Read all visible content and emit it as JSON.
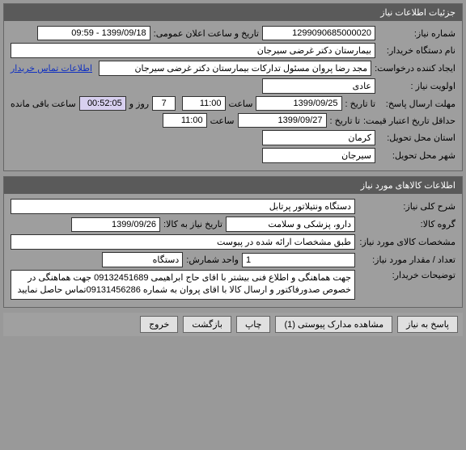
{
  "sections": {
    "need_info": {
      "title": "جزئیات اطلاعات نیاز",
      "rows": {
        "need_no_label": "شماره نیاز:",
        "need_no": "1299090685000020",
        "pub_datetime_label": "تاریخ و ساعت اعلان عمومی:",
        "pub_datetime": "1399/09/18 - 09:59",
        "buyer_org_label": "نام دستگاه خریدار:",
        "buyer_org": "بیمارستان دکتر غرضی سیرجان",
        "requester_label": "ایجاد کننده درخواست:",
        "requester": "مجد رضا پروان مسئول تدارکات بیمارستان دکتر غرضی سیرجان",
        "contact_link": "اطلاعات تماس خریدار",
        "priority_label": "اولویت نیاز :",
        "priority": "عادی",
        "reply_deadline_label": "مهلت ارسال پاسخ:",
        "until_label": "تا تاریخ :",
        "reply_until_date": "1399/09/25",
        "hour_label": "ساعت",
        "reply_until_time": "11:00",
        "days_remain": "7",
        "days_and": "روز و",
        "time_remain": "00:52:05",
        "time_remain_suffix": "ساعت باقی مانده",
        "min_validity_label": "حداقل تاریخ اعتبار قیمت:",
        "min_validity_date": "1399/09/27",
        "min_validity_time": "11:00",
        "delivery_province_label": "استان محل تحویل:",
        "delivery_province": "کرمان",
        "delivery_city_label": "شهر محل تحویل:",
        "delivery_city": "سیرجان"
      }
    },
    "goods_info": {
      "title": "اطلاعات کالاهای مورد نیاز",
      "rows": {
        "general_desc_label": "شرح کلی نیاز:",
        "general_desc": "دستگاه ونتیلاتور پرتابل",
        "goods_group_label": "گروه کالا:",
        "goods_group": "دارو، پزشکی و سلامت",
        "need_until_label": "تاریخ نیاز به کالا:",
        "need_until": "1399/09/26",
        "goods_spec_label": "مشخصات کالای مورد نیاز:",
        "goods_spec": "طبق مشخصات ارائه شده در پیوست",
        "qty_label": "تعداد / مقدار مورد نیاز:",
        "qty": "1",
        "unit_label": "واحد شمارش:",
        "unit": "دستگاه",
        "buyer_notes_label": "توضیحات خریدار:",
        "buyer_notes": "جهت هماهنگی و اطلاع فنی بیشتر با اقای حاج ابراهیمی 09132451689 جهت هماهنگی در خصوص صدورفاکتور و ارسال کالا با اقای پروان به شماره 09131456286تماس حاصل نمایید"
      }
    }
  },
  "buttons": {
    "reply": "پاسخ به نیاز",
    "attachments": "مشاهده مدارک پیوستی  (1)",
    "print": "چاپ",
    "back": "بازگشت",
    "exit": "خروج"
  }
}
